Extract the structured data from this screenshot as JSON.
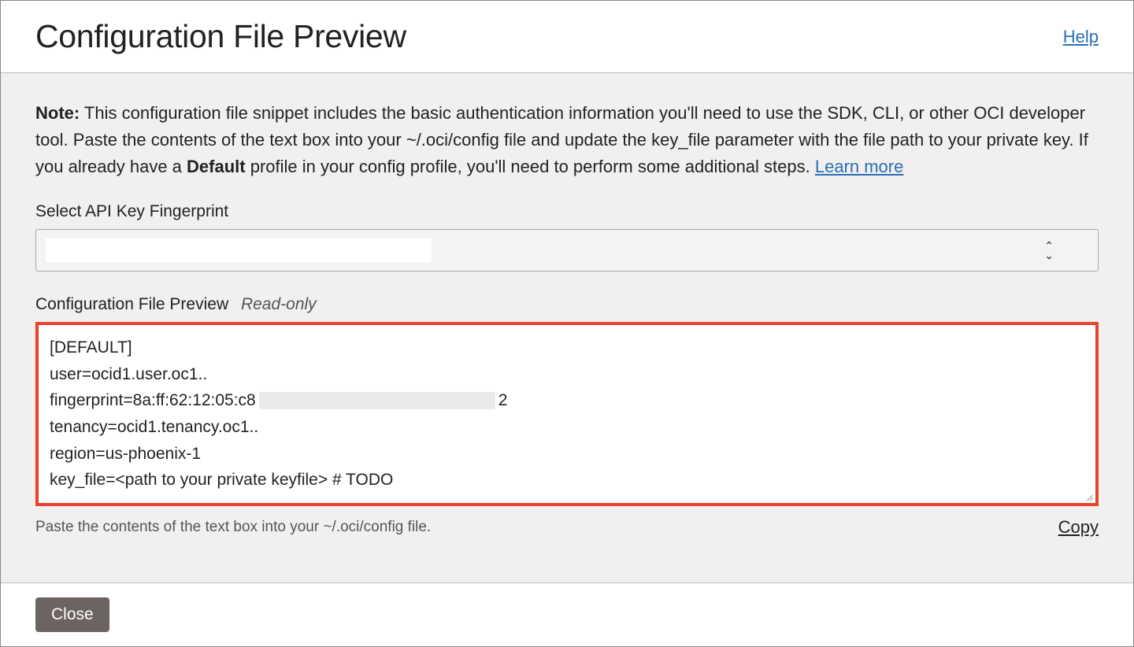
{
  "header": {
    "title": "Configuration File Preview",
    "help_link": "Help"
  },
  "note": {
    "label": "Note:",
    "body_before_default": " This configuration file snippet includes the basic authentication information you'll need to use the SDK, CLI, or other OCI developer tool. Paste the contents of the text box into your ~/.oci/config file and update the key_file parameter with the file path to your private key. If you already have a ",
    "default_word": "Default",
    "body_after_default": " profile in your config profile, you'll need to perform some additional steps. ",
    "learn_more": "Learn more"
  },
  "fingerprint": {
    "label": "Select API Key Fingerprint",
    "selected_value": ""
  },
  "preview": {
    "label": "Configuration File Preview",
    "readonly_label": "Read-only",
    "lines": {
      "l0": "[DEFAULT]",
      "l1": "user=ocid1.user.oc1..",
      "l2_prefix": "fingerprint=8a:ff:62:12:05:c8",
      "l2_suffix": "2",
      "l3": "tenancy=ocid1.tenancy.oc1..",
      "l4": "region=us-phoenix-1",
      "l5": "key_file=<path to your private keyfile> # TODO"
    },
    "hint": "Paste the contents of the text box into your ~/.oci/config file.",
    "copy": "Copy"
  },
  "footer": {
    "close": "Close"
  }
}
